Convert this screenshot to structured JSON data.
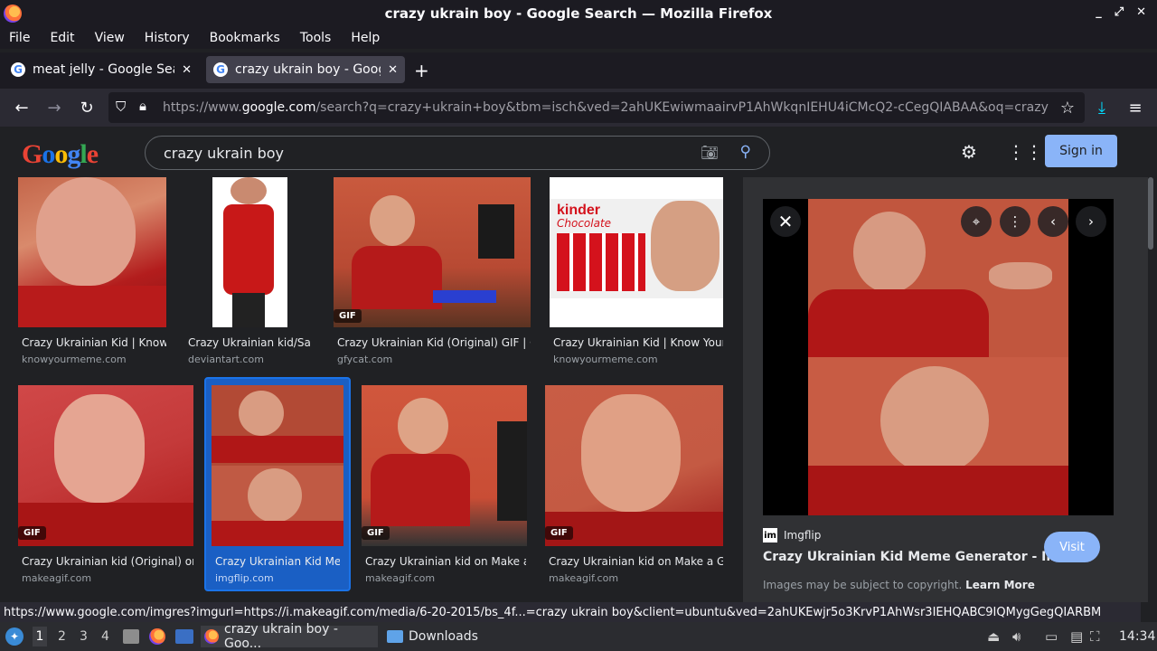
{
  "window": {
    "title": "crazy ukrain boy - Google Search — Mozilla Firefox",
    "controls": [
      "_",
      "⤢",
      "✕"
    ]
  },
  "menu": [
    "File",
    "Edit",
    "View",
    "History",
    "Bookmarks",
    "Tools",
    "Help"
  ],
  "tabs": [
    {
      "label": "meat jelly - Google Search",
      "active": false
    },
    {
      "label": "crazy ukrain boy - Google Search",
      "active": true
    }
  ],
  "url": {
    "prefix": "https://www.",
    "host": "google.com",
    "path": "/search?q=crazy+ukrain+boy&tbm=isch&ved=2ahUKEwiwmaairvP1AhWkqnIEHU4iCMcQ2-cCegQIABAA&oq=crazy"
  },
  "google": {
    "logo": "Google",
    "query": "crazy ukrain boy",
    "signin": "Sign in"
  },
  "results": [
    {
      "title": "Crazy Ukrainian Kid | Know...",
      "source": "knowyourmeme.com",
      "gif": false
    },
    {
      "title": "Crazy Ukrainian kid/Sa...",
      "source": "deviantart.com",
      "gif": false
    },
    {
      "title": "Crazy Ukrainian Kid (Original) GIF | G...",
      "source": "gfycat.com",
      "gif": true
    },
    {
      "title": "Crazy Ukrainian Kid | Know Your...",
      "source": "knowyourmeme.com",
      "gif": false
    },
    {
      "title": "Crazy Ukrainian kid (Original) on...",
      "source": "makeagif.com",
      "gif": true
    },
    {
      "title": "Crazy Ukrainian Kid Me...",
      "source": "imgflip.com",
      "gif": false
    },
    {
      "title": "Crazy Ukrainian kid on Make a...",
      "source": "makeagif.com",
      "gif": true
    },
    {
      "title": "Crazy Ukrainian kid on Make a GIF",
      "source": "makeagif.com",
      "gif": true
    }
  ],
  "badge": {
    "gif": "GIF"
  },
  "kinder": {
    "brand": "kinder",
    "sub": "Chocolate"
  },
  "panel": {
    "source": "Imgflip",
    "title": "Crazy Ukrainian Kid Meme Generator - Im...",
    "visit": "Visit",
    "copyright": "Images may be subject to copyright.",
    "learn_more": "Learn More"
  },
  "status": "https://www.google.com/imgres?imgurl=https://i.makeagif.com/media/6-20-2015/bs_4f...=crazy ukrain boy&client=ubuntu&ved=2ahUKEwjr5o3KrvP1AhWsr3IEHQABC9IQMygGegQIARBM",
  "taskbar": {
    "workspaces": [
      "1",
      "2",
      "3",
      "4"
    ],
    "tasks": [
      {
        "label": "crazy ukrain boy - Goo..."
      },
      {
        "label": "Downloads"
      }
    ],
    "clock": "14:34"
  },
  "colors": {
    "accent": "#8ab4f8",
    "page_bg": "#202124",
    "panel_bg": "#303134",
    "selected": "#1a73e8"
  }
}
